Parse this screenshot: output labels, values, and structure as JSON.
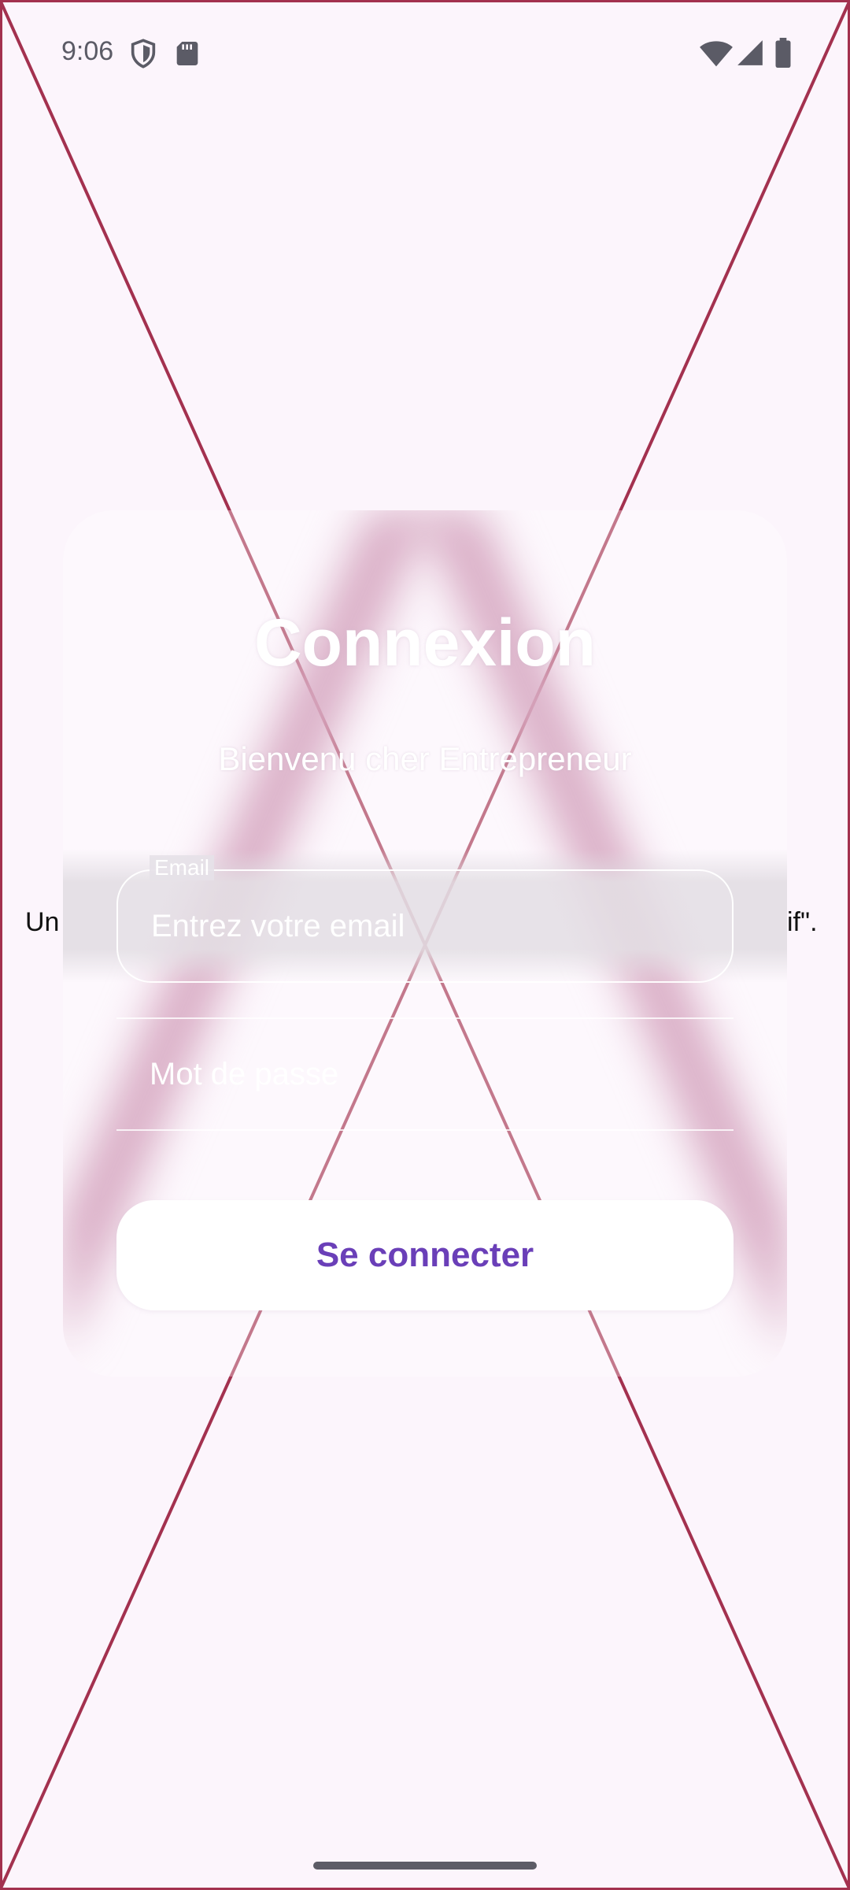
{
  "status_bar": {
    "time": "9:06",
    "icons_left": [
      "shield-icon",
      "sd-card-icon"
    ],
    "icons_right": [
      "wifi-icon",
      "signal-icon",
      "battery-icon"
    ]
  },
  "background": {
    "left_text": "Un",
    "right_text": "if\"."
  },
  "login": {
    "title": "Connexion",
    "subtitle": "Bienvenu cher Entrepreneur",
    "email_label": "Email",
    "email_placeholder": "Entrez votre email",
    "password_placeholder": "Mot de passe",
    "submit_label": "Se connecter"
  },
  "colors": {
    "accent": "#6a3fb8",
    "background": "#fcf5fc",
    "frame": "#a3314f"
  }
}
